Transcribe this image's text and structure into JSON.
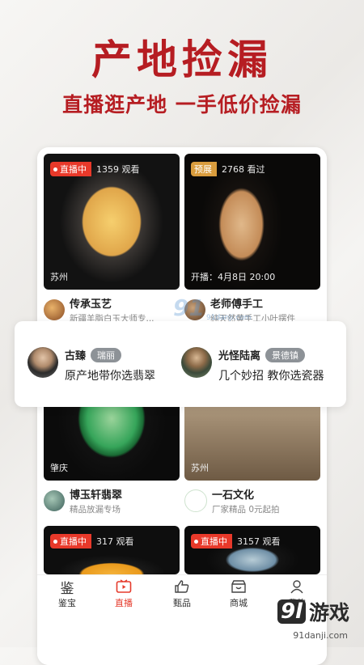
{
  "hero": {
    "title": "产地捡漏",
    "subtitle": "直播逛产地 一手低价捡漏"
  },
  "cards": [
    {
      "status": "直播中",
      "count": "1359",
      "count_label": "观看",
      "location": "苏州",
      "name": "传承玉艺",
      "desc": "新疆羊脂白玉大师专..."
    },
    {
      "status": "预展",
      "count": "2768",
      "count_label": "看过",
      "start": "开播：4月8日 20:00",
      "name": "老师傅手工",
      "desc": "纯天然黄手工小叶摆件"
    },
    {
      "location": "肇庆",
      "name": "博玉轩翡翠",
      "desc": "精品放漏专场"
    },
    {
      "location": "苏州",
      "name": "一石文化",
      "desc": "厂家精品 0元起拍"
    },
    {
      "status": "直播中",
      "count": "317",
      "count_label": "观看"
    },
    {
      "status": "直播中",
      "count": "3157",
      "count_label": "观看"
    }
  ],
  "hosts": [
    {
      "name": "古臻",
      "tag": "瑞丽",
      "desc": "原产地带你选翡翠"
    },
    {
      "name": "光怪陆离",
      "tag": "景德镇",
      "desc": "几个妙招 教你选瓷器"
    }
  ],
  "nav": {
    "items": [
      {
        "label": "鉴宝",
        "icon": "jianbao-icon"
      },
      {
        "label": "直播",
        "icon": "live-tv-icon"
      },
      {
        "label": "甄品",
        "icon": "thumbs-up-icon"
      },
      {
        "label": "商城",
        "icon": "shop-icon"
      },
      {
        "label": "我的",
        "icon": "user-icon"
      }
    ],
    "active_color": "#e53a2b"
  },
  "watermark": {
    "mark": "91",
    "site_center": "91danji.com"
  },
  "logo": {
    "mark": "9l",
    "brand": "游戏",
    "site": "91danji.com"
  },
  "colors": {
    "brand_red": "#b61d22",
    "live_red": "#e8392a",
    "preview_gold": "#d99c3d"
  }
}
